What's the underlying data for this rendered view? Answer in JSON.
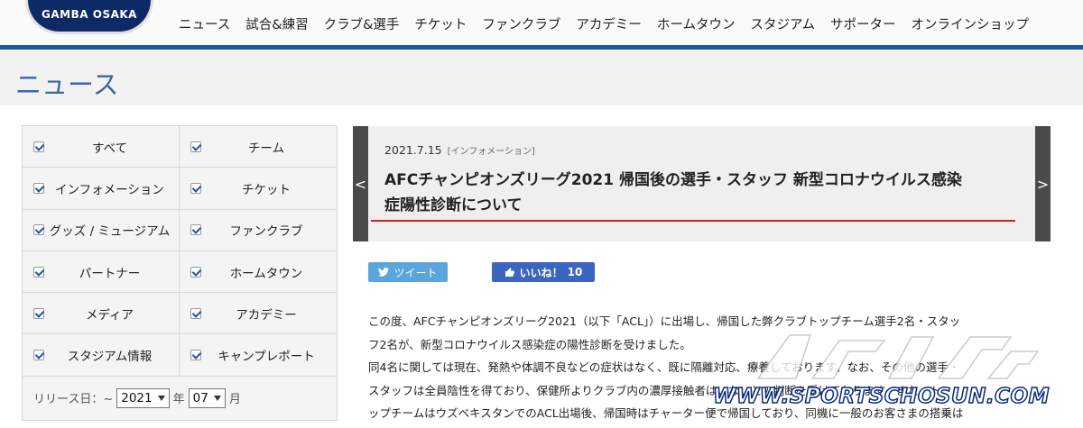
{
  "header": {
    "logo_text": "GAMBA OSAKA",
    "nav": [
      "ニュース",
      "試合&練習",
      "クラブ&選手",
      "チケット",
      "ファンクラブ",
      "アカデミー",
      "ホームタウン",
      "スタジアム",
      "サポーター",
      "オンラインショップ"
    ]
  },
  "page": {
    "title": "ニュース"
  },
  "filters": {
    "categories": [
      {
        "label": "すべて",
        "checked": true
      },
      {
        "label": "チーム",
        "checked": true
      },
      {
        "label": "インフォメーション",
        "checked": true
      },
      {
        "label": "チケット",
        "checked": true
      },
      {
        "label": "グッズ / ミュージアム",
        "checked": true
      },
      {
        "label": "ファンクラブ",
        "checked": true
      },
      {
        "label": "パートナー",
        "checked": true
      },
      {
        "label": "ホームタウン",
        "checked": true
      },
      {
        "label": "メディア",
        "checked": true
      },
      {
        "label": "アカデミー",
        "checked": true
      },
      {
        "label": "スタジアム情報",
        "checked": true
      },
      {
        "label": "キャンプレポート",
        "checked": true
      }
    ],
    "release_label": "リリース日：~",
    "year_value": "2021",
    "year_suffix": "年",
    "month_value": "07",
    "month_suffix": "月"
  },
  "article": {
    "date": "2021.7.15",
    "category": "[インフォメーション]",
    "title_line1": "AFCチャンピオンズリーグ2021 帰国後の選手・スタッフ 新型コロナウイルス感染",
    "title_line2": "症陽性診断について",
    "prev_arrow": "<",
    "next_arrow": ">"
  },
  "social": {
    "tweet_label": "ツイート",
    "like_label": "いいね！",
    "like_count": "10"
  },
  "body": {
    "lines": [
      "この度、AFCチャンピオンズリーグ2021（以下「ACL」）に出場し、帰国した弊クラブトップチーム選手2名・スタッ",
      "フ2名が、新型コロナウイルス感染症の陽性診断を受けました。",
      "同4名に関しては現在、発熱や体調不良などの症状はなく、既に隔離対応、療養しております。なお、その他の選手・",
      "スタッフは全員陰性を得ており、保健所よりクラブ内の濃厚接触者はいないとの判断を受けております。また、ト",
      "ップチームはウズベキスタンでのACL出場後、帰国時はチャーター便で帰国しており、同機に一般のお客さまの搭乗は"
    ]
  },
  "watermark": {
    "url": "WWW.SPORTSCHOSUN.COM"
  },
  "colors": {
    "brand_blue": "#1d56a0",
    "title_red": "#e01919",
    "tweet_blue": "#5aa5dc",
    "facebook_blue": "#3b65c0"
  }
}
